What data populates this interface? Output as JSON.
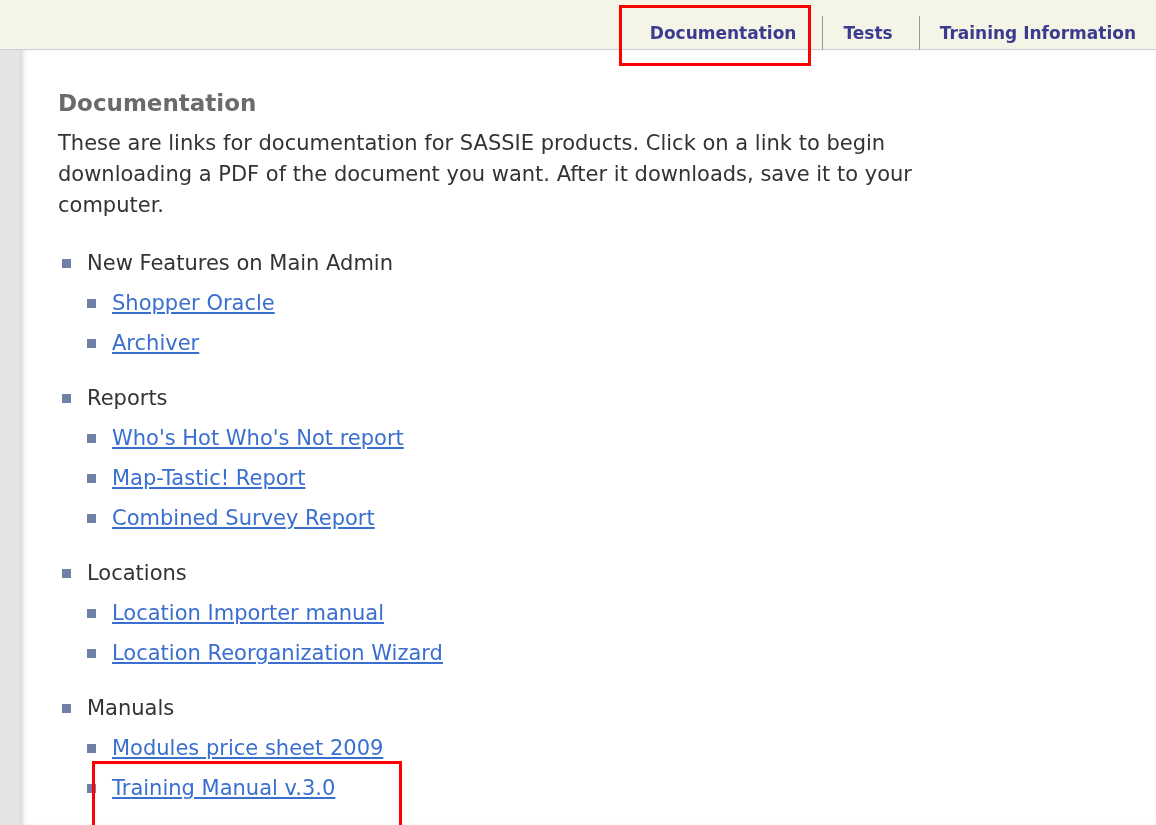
{
  "tabs": [
    {
      "label": "Documentation",
      "highlighted": true
    },
    {
      "label": "Tests",
      "highlighted": false
    },
    {
      "label": "Training Information",
      "highlighted": false
    }
  ],
  "heading": "Documentation",
  "intro": "These are links for documentation for SASSIE products. Click on a link to begin downloading a PDF of the document you want. After it downloads, save it to your computer.",
  "sections": [
    {
      "title": "New Features on Main Admin",
      "links": [
        {
          "label": "Shopper Oracle",
          "highlighted": false
        },
        {
          "label": "Archiver",
          "highlighted": false
        }
      ]
    },
    {
      "title": "Reports",
      "links": [
        {
          "label": "Who's Hot Who's Not report",
          "highlighted": false
        },
        {
          "label": "Map-Tastic! Report",
          "highlighted": false
        },
        {
          "label": "Combined Survey Report",
          "highlighted": false
        }
      ]
    },
    {
      "title": "Locations",
      "links": [
        {
          "label": "Location Importer manual",
          "highlighted": false
        },
        {
          "label": "Location Reorganization Wizard",
          "highlighted": false
        }
      ]
    },
    {
      "title": "Manuals",
      "links": [
        {
          "label": "Modules price sheet 2009",
          "highlighted": false
        },
        {
          "label": "Training Manual v.3.0",
          "highlighted": true
        }
      ]
    }
  ]
}
